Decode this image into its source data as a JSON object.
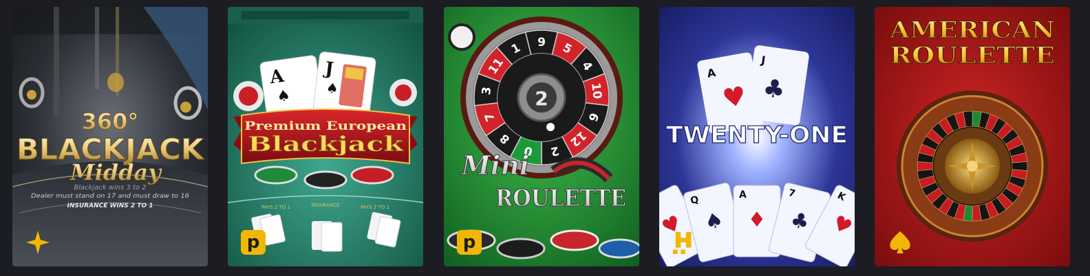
{
  "games": [
    {
      "title_top": "360°",
      "title_main": "BLACKJACK",
      "title_sub": "Midday",
      "fine_1": "Blackjack wins 3 to 2",
      "fine_2": "Dealer must stand on 17 and must draw to 16",
      "fine_3": "INSURANCE WINS 2 TO 1",
      "provider_icon": "star-icon"
    },
    {
      "card_1": "A",
      "card_2": "J",
      "banner_top": "Premium European",
      "banner_main": "Blackjack",
      "table_1": "PAYS 2 TO 1",
      "table_2": "INSURANCE",
      "table_3": "PAYS 2 TO 1",
      "provider_label": "p",
      "provider_icon": "pragmatic-p-icon"
    },
    {
      "wheel_numbers": [
        "9",
        "5",
        "4",
        "10",
        "6",
        "12",
        "2",
        "0",
        "8",
        "7",
        "3",
        "11",
        "1"
      ],
      "center_number": "2",
      "title_top": "Mini",
      "title_main": "ROULETTE",
      "provider_label": "p",
      "provider_icon": "pragmatic-p-icon"
    },
    {
      "card_1": "A",
      "card_2": "J",
      "title": "TWENTY-ONE",
      "hand_cards": [
        "K",
        "Q",
        "A",
        "7",
        "K"
      ],
      "provider_icon": "h-logo-icon"
    },
    {
      "title_line_1": "AMERICAN",
      "title_line_2": "ROULETTE",
      "provider_icon": "spade-icon"
    }
  ],
  "colors": {
    "accent_gold": "#f2b705",
    "page_bg": "#1b1d23"
  }
}
